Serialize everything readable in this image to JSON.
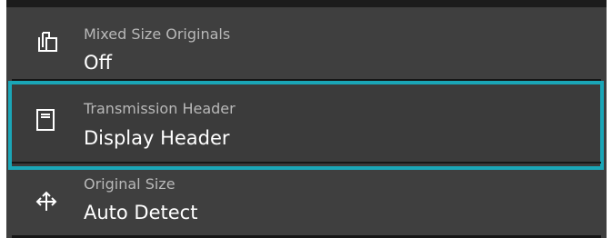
{
  "settings": {
    "items": [
      {
        "label": "Mixed Size Originals",
        "value": "Off",
        "icon": "mixed-size-icon"
      },
      {
        "label": "Transmission Header",
        "value": "Display Header",
        "icon": "header-document-icon"
      },
      {
        "label": "Original Size",
        "value": "Auto Detect",
        "icon": "move-arrows-icon"
      }
    ],
    "selected_index": 1
  },
  "colors": {
    "panel_background": "#3f3f3f",
    "selection_border": "#1aa6b7",
    "label_text": "#b8b8b8",
    "value_text": "#ffffff"
  }
}
